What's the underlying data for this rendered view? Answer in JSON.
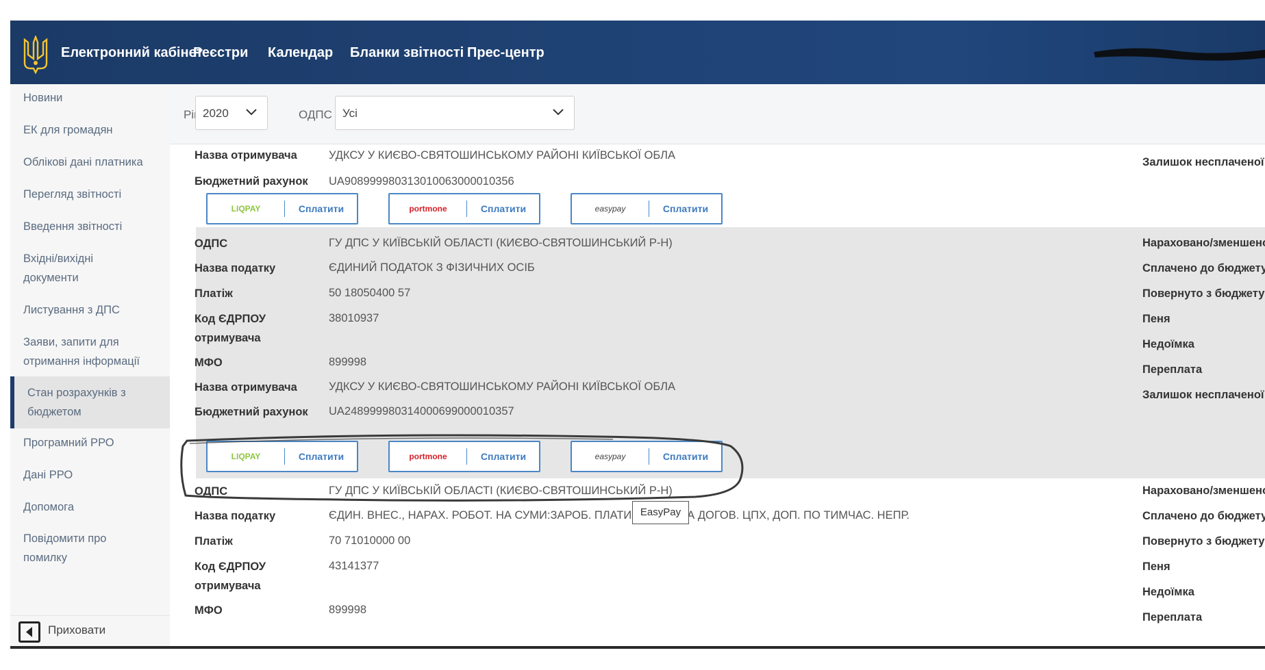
{
  "header": {
    "brand": "Електронний кабінет",
    "nav": [
      "Реєстри",
      "Календар",
      "Бланки звітності",
      "Прес-центр"
    ]
  },
  "sidebar": {
    "items": [
      "Новини",
      "ЕК для громадян",
      "Облікові дані платника",
      "Перегляд звітності",
      "Введення звітності",
      "Вхідні/вихідні документи",
      "Листування з ДПС",
      "Заяви, запити для отримання інформації",
      "Стан розрахунків з бюджетом",
      "Програмний РРО",
      "Дані РРО",
      "Допомога",
      "Повідомити про помилку"
    ],
    "active_index": 8,
    "hide_label": "Приховати"
  },
  "filter": {
    "year_label": "Рік",
    "year_value": "2020",
    "odps_label": "ОДПС",
    "odps_value": "Усі"
  },
  "labels": {
    "odps": "ОДПС",
    "tax_name": "Назва податку",
    "payment": "Платіж",
    "edrpou": "Код ЄДРПОУ отримувача",
    "mfo": "МФО",
    "recipient": "Назва отримувача",
    "account": "Бюджетний рахунок"
  },
  "right_labels": [
    "Нараховано/зменшено",
    "Сплачено до бюджету",
    "Повернуто з бюджету",
    "Пеня",
    "Недоїмка",
    "Переплата",
    "Залишок несплаченої пені"
  ],
  "block1": {
    "recipient": "УДКСУ У КИЄВО-СВЯТОШИНСЬКОМУ РАЙОНІ КИЇВСЬКОЇ ОБЛА",
    "account": "UA908999980313010063000010356"
  },
  "block2": {
    "odps": "ГУ ДПС У КИЇВСЬКІЙ ОБЛАСТІ (КИЄВО-СВЯТОШИНСЬКИЙ Р-Н)",
    "tax_name": "ЄДИНИЙ ПОДАТОК З ФІЗИЧНИХ ОСІБ",
    "payment": "50 18050400 57",
    "edrpou": "38010937",
    "mfo": "899998",
    "recipient": "УДКСУ У КИЄВО-СВЯТОШИНСЬКОМУ РАЙОНІ КИЇВСЬКОЇ ОБЛА",
    "account": "UA248999980314000699000010357"
  },
  "block3": {
    "odps": "ГУ ДПС У КИЇВСЬКІЙ ОБЛАСТІ (КИЄВО-СВЯТОШИНСЬКИЙ Р-Н)",
    "tax_name": "ЄДИН. ВНЕС., НАРАХ. РОБОТ. НА СУМИ:ЗАРОБ. ПЛАТИ, ВИНАГ. ЗА ДОГОВ. ЦПХ, ДОП. ПО ТИМЧАС. НЕПР.",
    "payment": "70 71010000 00",
    "edrpou": "43141377",
    "mfo": "899998"
  },
  "pay": {
    "button_label": "Сплатити",
    "liqpay_logo": "LIQPAY",
    "portmone_logo": "portmone",
    "easypay_logo": "easypay"
  },
  "tooltip": "EasyPay",
  "colors": {
    "header": "#1f4274",
    "accent": "#3d7abf",
    "band": "#e6e6e6"
  }
}
